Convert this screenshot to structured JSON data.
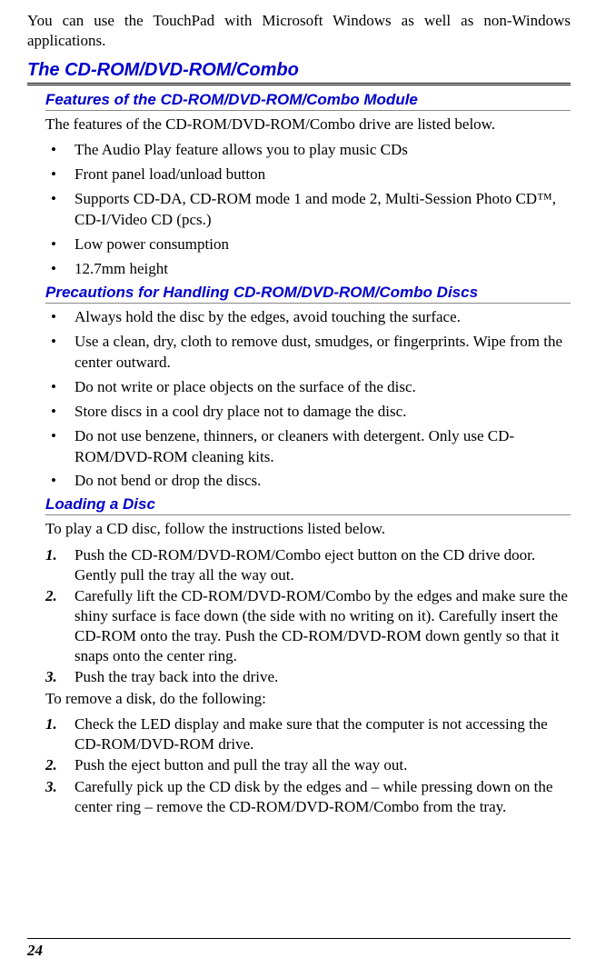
{
  "intro": "You can use the TouchPad with Microsoft Windows as well as non-Windows applications.",
  "sectionTitle": "The CD-ROM/DVD-ROM/Combo",
  "features": {
    "title": "Features of the CD-ROM/DVD-ROM/Combo Module",
    "lead": "The features of the CD-ROM/DVD-ROM/Combo drive are listed below.",
    "items": [
      "The Audio Play feature allows you to play music CDs",
      "Front panel load/unload button",
      "Supports CD-DA, CD-ROM mode 1 and mode 2, Multi-Session Photo CD™, CD-I/Video CD (pcs.)",
      "Low power consumption",
      "12.7mm height"
    ]
  },
  "precautions": {
    "title": "Precautions for Handling CD-ROM/DVD-ROM/Combo Discs",
    "items": [
      "Always hold the disc by the edges, avoid touching the surface.",
      "Use a clean, dry, cloth to remove dust, smudges, or fingerprints.  Wipe from the center outward.",
      "Do not write or place objects on the surface of the disc.",
      "Store discs in a cool dry place not to damage the disc.",
      "Do not use benzene, thinners, or cleaners with detergent.  Only use CD-ROM/DVD-ROM cleaning kits.",
      "Do not bend or drop the discs."
    ]
  },
  "loading": {
    "title": "Loading a Disc",
    "lead": "To play a CD disc, follow the instructions listed below.",
    "steps": [
      "Push the CD-ROM/DVD-ROM/Combo eject button on the CD drive door.  Gently pull the tray all the way out.",
      "Carefully lift the CD-ROM/DVD-ROM/Combo by the edges and make sure the shiny surface is face down (the side with no writing on it).  Carefully insert the CD-ROM onto the tray.  Push the CD-ROM/DVD-ROM down gently so that it snaps onto the center ring.",
      "Push the tray back into the drive."
    ],
    "removeLead": "To remove a disk, do the following:",
    "removeSteps": [
      "Check the LED display and make sure that the computer is not accessing the CD-ROM/DVD-ROM drive.",
      "Push the eject button and pull the tray all the way out.",
      "Carefully pick up the CD disk by the edges and – while pressing down on the center ring – remove the CD-ROM/DVD-ROM/Combo from the tray."
    ]
  },
  "pageNumber": "24"
}
